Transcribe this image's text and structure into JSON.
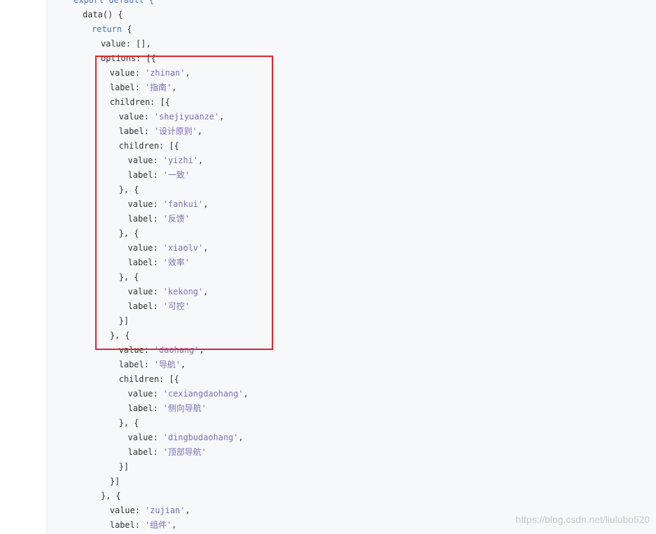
{
  "code_block": {
    "lines": [
      [
        {
          "t": "export default {",
          "k": "kw"
        }
      ],
      [
        {
          "t": "data() {",
          "k": "plain"
        }
      ],
      [
        {
          "t": "return",
          "k": "kw"
        },
        {
          "t": " {",
          "k": "plain"
        }
      ],
      [
        {
          "t": "value: [],",
          "k": "plain"
        }
      ],
      [
        {
          "t": "options: [{",
          "k": "plain"
        }
      ],
      [
        {
          "t": "value: ",
          "k": "plain"
        },
        {
          "t": "'zhinan'",
          "k": "str"
        },
        {
          "t": ",",
          "k": "plain"
        }
      ],
      [
        {
          "t": "label: ",
          "k": "plain"
        },
        {
          "t": "'指南'",
          "k": "str"
        },
        {
          "t": ",",
          "k": "plain"
        }
      ],
      [
        {
          "t": "children: [{",
          "k": "plain"
        }
      ],
      [
        {
          "t": "value: ",
          "k": "plain"
        },
        {
          "t": "'shejiyuanze'",
          "k": "str"
        },
        {
          "t": ",",
          "k": "plain"
        }
      ],
      [
        {
          "t": "label: ",
          "k": "plain"
        },
        {
          "t": "'设计原则'",
          "k": "str"
        },
        {
          "t": ",",
          "k": "plain"
        }
      ],
      [
        {
          "t": "children: [{",
          "k": "plain"
        }
      ],
      [
        {
          "t": "value: ",
          "k": "plain"
        },
        {
          "t": "'yizhi'",
          "k": "str"
        },
        {
          "t": ",",
          "k": "plain"
        }
      ],
      [
        {
          "t": "label: ",
          "k": "plain"
        },
        {
          "t": "'一致'",
          "k": "str"
        }
      ],
      [
        {
          "t": "}, {",
          "k": "plain"
        }
      ],
      [
        {
          "t": "value: ",
          "k": "plain"
        },
        {
          "t": "'fankui'",
          "k": "str"
        },
        {
          "t": ",",
          "k": "plain"
        }
      ],
      [
        {
          "t": "label: ",
          "k": "plain"
        },
        {
          "t": "'反馈'",
          "k": "str"
        }
      ],
      [
        {
          "t": "}, {",
          "k": "plain"
        }
      ],
      [
        {
          "t": "value: ",
          "k": "plain"
        },
        {
          "t": "'xiaolv'",
          "k": "str"
        },
        {
          "t": ",",
          "k": "plain"
        }
      ],
      [
        {
          "t": "label: ",
          "k": "plain"
        },
        {
          "t": "'效率'",
          "k": "str"
        }
      ],
      [
        {
          "t": "}, {",
          "k": "plain"
        }
      ],
      [
        {
          "t": "value: ",
          "k": "plain"
        },
        {
          "t": "'kekong'",
          "k": "str"
        },
        {
          "t": ",",
          "k": "plain"
        }
      ],
      [
        {
          "t": "label: ",
          "k": "plain"
        },
        {
          "t": "'可控'",
          "k": "str"
        }
      ],
      [
        {
          "t": "}]",
          "k": "plain"
        }
      ],
      [
        {
          "t": "}, {",
          "k": "plain"
        }
      ],
      [
        {
          "t": "value: ",
          "k": "plain"
        },
        {
          "t": "'daohang'",
          "k": "str"
        },
        {
          "t": ",",
          "k": "plain"
        }
      ],
      [
        {
          "t": "label: ",
          "k": "plain"
        },
        {
          "t": "'导航'",
          "k": "str"
        },
        {
          "t": ",",
          "k": "plain"
        }
      ],
      [
        {
          "t": "children: [{",
          "k": "plain"
        }
      ],
      [
        {
          "t": "value: ",
          "k": "plain"
        },
        {
          "t": "'cexiangdaohang'",
          "k": "str"
        },
        {
          "t": ",",
          "k": "plain"
        }
      ],
      [
        {
          "t": "label: ",
          "k": "plain"
        },
        {
          "t": "'侧向导航'",
          "k": "str"
        }
      ],
      [
        {
          "t": "}, {",
          "k": "plain"
        }
      ],
      [
        {
          "t": "value: ",
          "k": "plain"
        },
        {
          "t": "'dingbudaohang'",
          "k": "str"
        },
        {
          "t": ",",
          "k": "plain"
        }
      ],
      [
        {
          "t": "label: ",
          "k": "plain"
        },
        {
          "t": "'顶部导航'",
          "k": "str"
        }
      ],
      [
        {
          "t": "}]",
          "k": "plain"
        }
      ],
      [
        {
          "t": "}]",
          "k": "plain"
        }
      ],
      [
        {
          "t": "}, {",
          "k": "plain"
        }
      ],
      [
        {
          "t": "value: ",
          "k": "plain"
        },
        {
          "t": "'zujian'",
          "k": "str"
        },
        {
          "t": ",",
          "k": "plain"
        }
      ],
      [
        {
          "t": "label: ",
          "k": "plain"
        },
        {
          "t": "'组件'",
          "k": "str"
        },
        {
          "t": ",",
          "k": "plain"
        }
      ]
    ]
  },
  "highlight": {
    "color": "#e0242b"
  },
  "watermark": {
    "text": "https://blog.csdn.net/liulubo520"
  }
}
